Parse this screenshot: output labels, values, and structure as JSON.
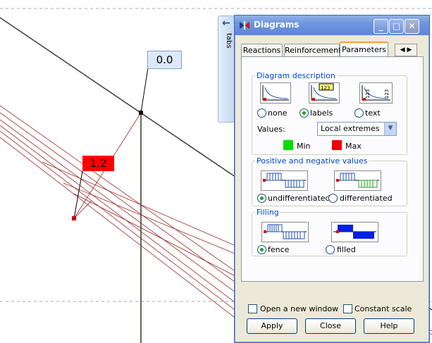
{
  "canvas": {
    "zero_label": "0.0",
    "max_label": "1.2",
    "max_color": "#ff0000"
  },
  "side_tab": {
    "label": "tabs"
  },
  "window": {
    "title": "Diagrams",
    "tabs": [
      "Reactions",
      "Reinforcement",
      "Parameters"
    ],
    "active_tab": "Parameters",
    "diagram_description": {
      "title": "Diagram description",
      "options": [
        "none",
        "labels",
        "text"
      ],
      "selected": "labels",
      "label_icon_text": "123",
      "values_label": "Values:",
      "values_selected": "Local extremes",
      "min_label": "Min",
      "max_label": "Max",
      "min_color": "#00dd00",
      "max_color": "#ee0000"
    },
    "positive_negative": {
      "title": "Positive and negative values",
      "options": [
        "undifferentiated",
        "differentiated"
      ],
      "selected": "undifferentiated"
    },
    "filling": {
      "title": "Filling",
      "options": [
        "fence",
        "filled"
      ],
      "selected": "fence"
    },
    "open_new_window_label": "Open a new window",
    "open_new_window_checked": false,
    "constant_scale_label": "Constant scale",
    "constant_scale_checked": false,
    "buttons": {
      "apply": "Apply",
      "close": "Close",
      "help": "Help"
    }
  }
}
